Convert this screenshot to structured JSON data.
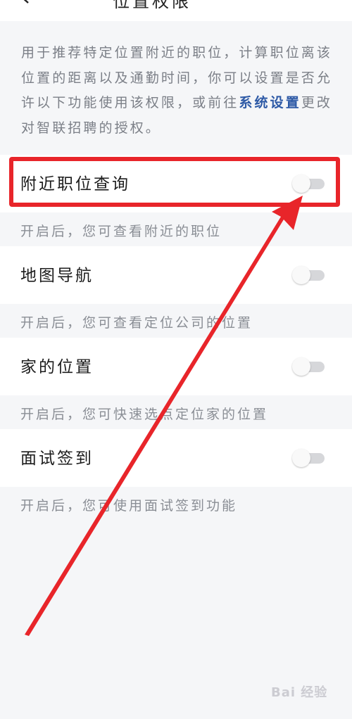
{
  "top_bar": {
    "title": "位置权限"
  },
  "intro": {
    "text": "用于推荐特定位置附近的职位，计算职位离该位置的距离以及通勤时间，你可以设置是否允许以下功能使用该权限，或前往",
    "link": "系统设置",
    "suffix": "更改对智联招聘的授权。"
  },
  "settings": [
    {
      "label": "附近职位查询",
      "hint": "开启后，您可查看附近的职位",
      "enabled": false
    },
    {
      "label": "地图导航",
      "hint": "开启后，您可查看定位公司的位置",
      "enabled": false
    },
    {
      "label": "家的位置",
      "hint": "开启后，您可快速选点定位家的位置",
      "enabled": false
    },
    {
      "label": "面试签到",
      "hint": "开启后，您可使用面试签到功能",
      "enabled": false
    }
  ],
  "colors": {
    "highlight": "#e8252a",
    "link": "#2e5aa6"
  },
  "watermark": "Bai 经验"
}
